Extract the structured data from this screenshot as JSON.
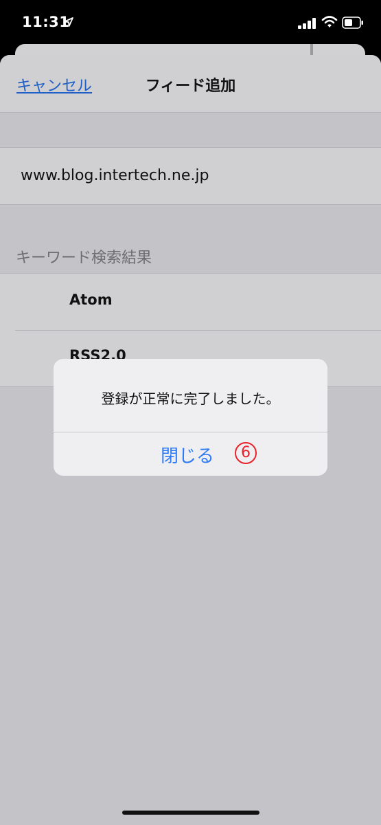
{
  "status_bar": {
    "time": "11:31",
    "icons": [
      "location-arrow-icon",
      "cellular-signal-icon",
      "wifi-icon",
      "battery-icon"
    ]
  },
  "nav": {
    "cancel_label": "キャンセル",
    "title": "フィード追加"
  },
  "url_field": {
    "value": "www.blog.intertech.ne.jp"
  },
  "results": {
    "header": "キーワード検索結果",
    "items": [
      {
        "label": "Atom"
      },
      {
        "label": "RSS2.0"
      }
    ]
  },
  "alert": {
    "message": "登録が正常に完了しました。",
    "close_label": "閉じる",
    "step_marker": "⑥"
  },
  "colors": {
    "link": "#1f5fc7",
    "alert_button": "#2f7bf5",
    "marker": "#e8212a"
  }
}
